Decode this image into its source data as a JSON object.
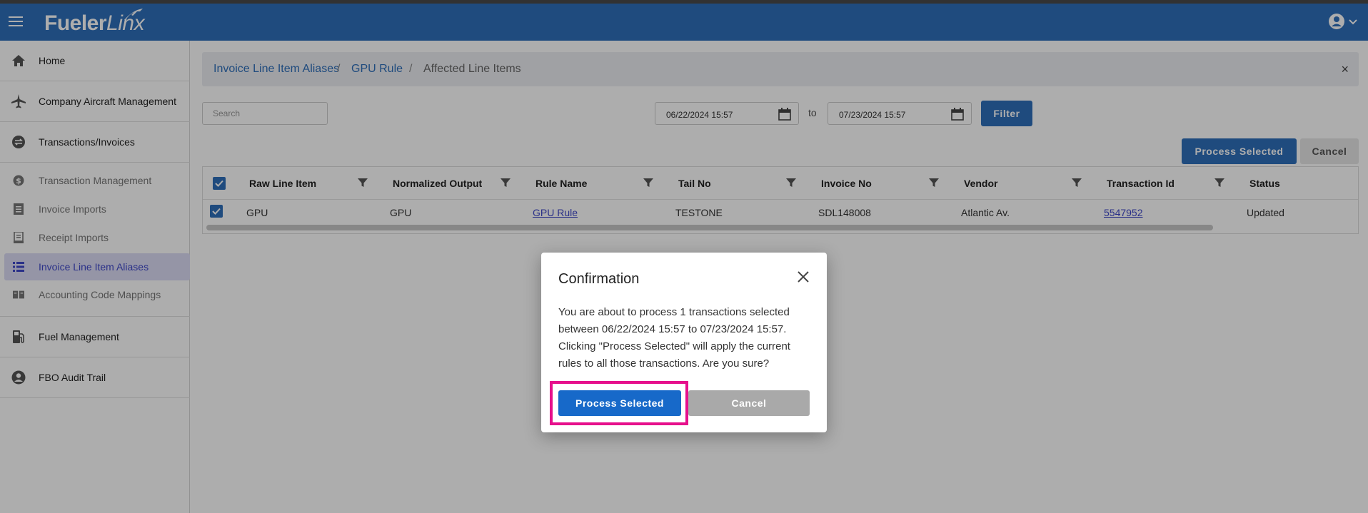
{
  "header": {
    "logo_main": "Fueler",
    "logo_italic": "Linx"
  },
  "sidebar": {
    "items": [
      {
        "label": "Home"
      },
      {
        "label": "Company Aircraft Management"
      },
      {
        "label": "Transactions/Invoices"
      },
      {
        "label": "Transaction Management"
      },
      {
        "label": "Invoice Imports"
      },
      {
        "label": "Receipt Imports"
      },
      {
        "label": "Invoice Line Item Aliases"
      },
      {
        "label": "Accounting Code Mappings"
      },
      {
        "label": "Fuel Management"
      },
      {
        "label": "FBO Audit Trail"
      }
    ]
  },
  "breadcrumb": {
    "items": [
      "Invoice Line Item Aliases",
      "GPU Rule",
      "Affected Line Items"
    ],
    "separator": "/",
    "close_glyph": "×"
  },
  "filters": {
    "search_placeholder": "Search",
    "date_from": "06/22/2024 15:57",
    "to_label": "to",
    "date_to": "07/23/2024 15:57",
    "filter_label": "Filter"
  },
  "actions": {
    "process_label": "Process Selected",
    "cancel_label": "Cancel"
  },
  "table": {
    "headers": [
      "Raw Line Item",
      "Normalized Output",
      "Rule Name",
      "Tail No",
      "Invoice No",
      "Vendor",
      "Transaction Id",
      "Status"
    ],
    "rows": [
      [
        "GPU",
        "GPU",
        "GPU Rule",
        "TESTONE",
        "SDL148008",
        "Atlantic Av.",
        "5547952",
        "Updated"
      ]
    ]
  },
  "dialog": {
    "title": "Confirmation",
    "message": "You are about to process 1 transactions selected between 06/22/2024 15:57 to 07/23/2024 15:57. Clicking \"Process Selected\" will apply the current rules to all those transactions. Are you sure?",
    "process_label": "Process Selected",
    "cancel_label": "Cancel"
  },
  "colors": {
    "brand": "#2f6fba",
    "highlight": "#e6108c",
    "active_nav": "#3e47c9"
  }
}
